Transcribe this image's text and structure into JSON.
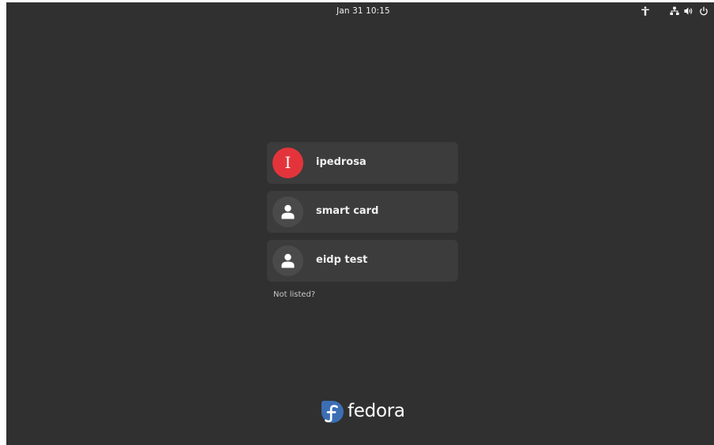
{
  "topbar": {
    "clock": "Jan 31  10:15",
    "icons": [
      "accessibility-icon",
      "network-icon",
      "volume-icon",
      "power-icon"
    ]
  },
  "users": [
    {
      "name": "ipedrosa",
      "avatar_initial": "I",
      "avatar_color": "#e4343b"
    },
    {
      "name": "smart card",
      "avatar_icon": "person-icon"
    },
    {
      "name": "eidp test",
      "avatar_icon": "person-icon"
    }
  ],
  "not_listed_label": "Not listed?",
  "logo": {
    "text": "fedora",
    "color": "#3c6eb4"
  },
  "colors": {
    "background": "#303030",
    "card": "#3c3c3c",
    "accent_red": "#e4343b"
  }
}
